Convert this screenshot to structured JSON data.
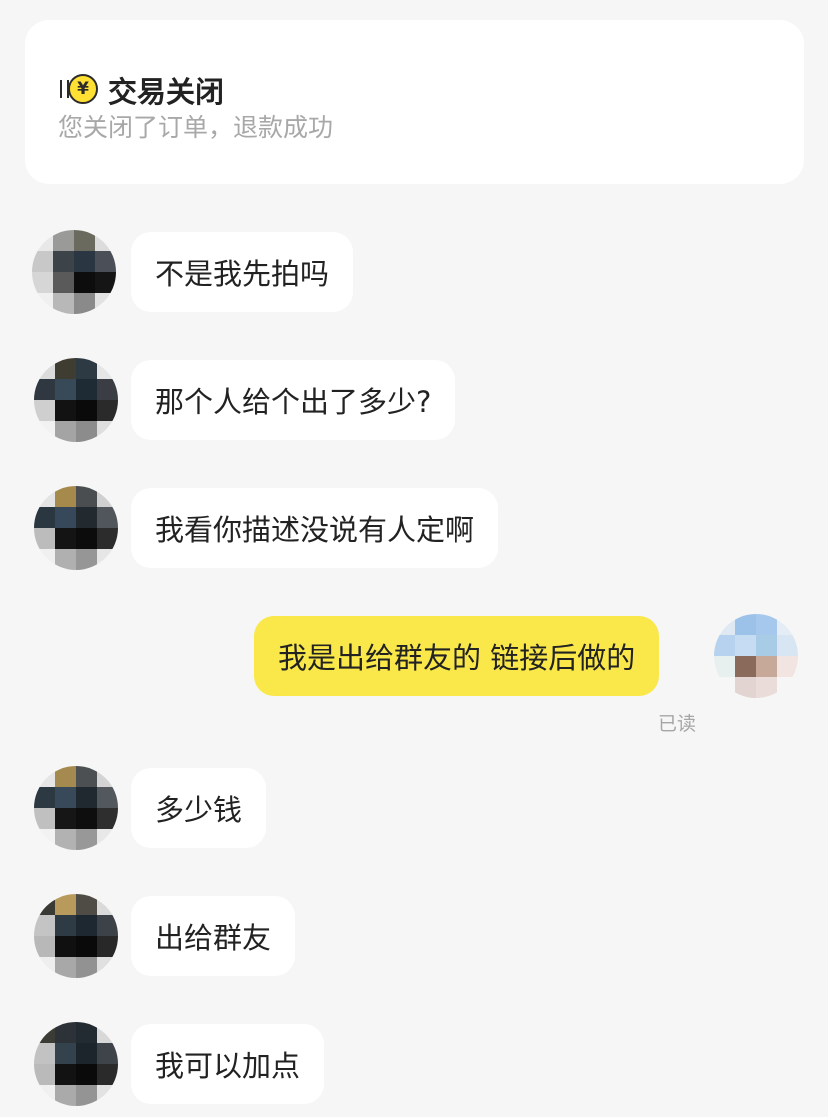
{
  "status_card": {
    "icon": "yen-coin-icon",
    "title": "交易关闭",
    "subtitle": "您关闭了订单，退款成功"
  },
  "messages": [
    {
      "side": "left",
      "text": "不是我先拍吗"
    },
    {
      "side": "left",
      "text": "那个人给个出了多少?"
    },
    {
      "side": "left",
      "text": "我看你描述没说有人定啊"
    },
    {
      "side": "right",
      "text": "我是出给群友的 链接后做的",
      "read_status": "已读"
    },
    {
      "side": "left",
      "text": "多少钱"
    },
    {
      "side": "left",
      "text": "出给群友"
    },
    {
      "side": "left",
      "text": "我可以加点"
    }
  ],
  "colors": {
    "background": "#f6f6f6",
    "own_bubble": "#fae84a",
    "other_bubble": "#ffffff",
    "coin": "#ffe033"
  }
}
